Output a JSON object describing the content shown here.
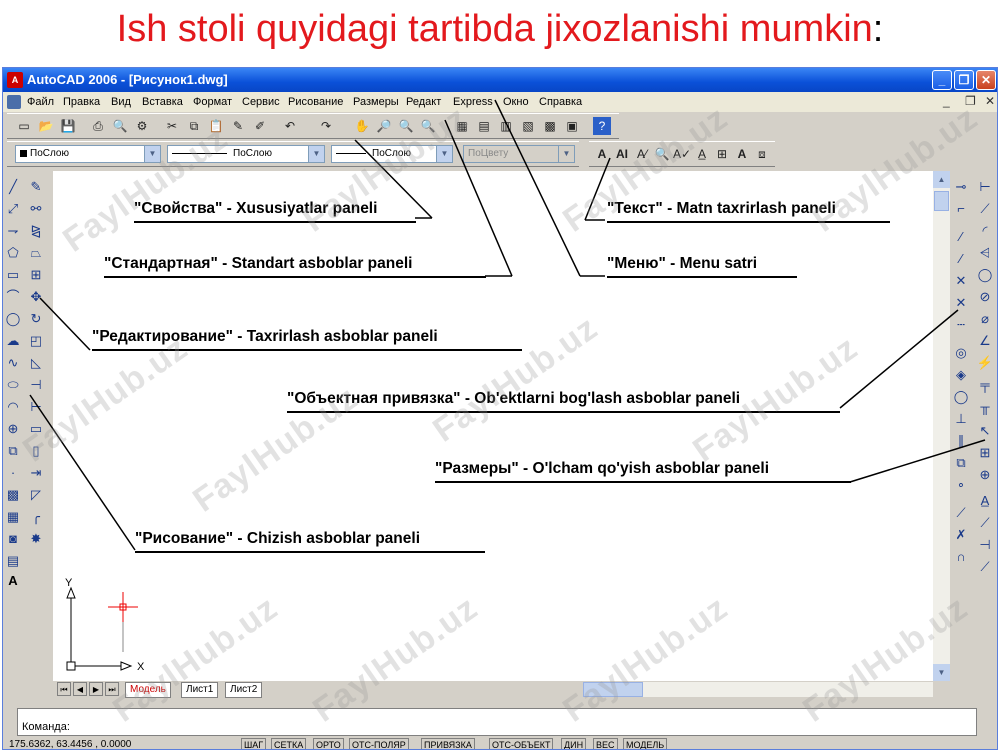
{
  "slide": {
    "title": "Ish stoli quyidagi tartibda jixozlanishi mumkin",
    "title_suffix": ":"
  },
  "window": {
    "title": "AutoCAD 2006 - [Рисунок1.dwg]",
    "menu": [
      "Файл",
      "Правка",
      "Вид",
      "Вставка",
      "Формат",
      "Сервис",
      "Рисование",
      "Размеры",
      "Редакт",
      "Express",
      "Окно",
      "Справка"
    ],
    "properties": {
      "color": "ПоСлою",
      "linetype": "ПоСлою",
      "lineweight": "ПоСлою",
      "plotstyle": "ПоЦвету"
    },
    "tabs": [
      "Модель",
      "Лист1",
      "Лист2"
    ],
    "command_prompt": "Команда:",
    "coordinates": "175.6362, 63.4456 , 0.0000",
    "status_buttons": [
      "ШАГ",
      "СЕТКА",
      "ОРТО",
      "ОТС-ПОЛЯР",
      "ПРИВЯЗКА",
      "ОТС-ОБЪЕКТ",
      "ДИН",
      "ВЕС",
      "МОДЕЛЬ"
    ],
    "ucs": {
      "x": "X",
      "y": "Y"
    }
  },
  "annotations": {
    "properties": "\"Свойства\" - Xususiyatlar paneli",
    "text": "\"Текст\" - Matn taxrirlash paneli",
    "standard": "\"Стандартная\" - Standart asboblar  paneli",
    "menu": "\"Меню\" - Menu satri",
    "modify": "\"Редактирование\" - Taxrirlash asboblar paneli",
    "osnap": "\"Объектная привязка\" - Ob'ektlarni bog'lash asboblar paneli",
    "dimension": "\"Размеры\" - O'lcham qo'yish asboblar paneli",
    "draw": "\"Рисование\" - Chizish asboblar paneli"
  },
  "watermark": "FaylHub.uz",
  "colors": {
    "title": "#e3191d",
    "titlebar": "#0a50d8",
    "ui_gray": "#d4d0c8"
  }
}
